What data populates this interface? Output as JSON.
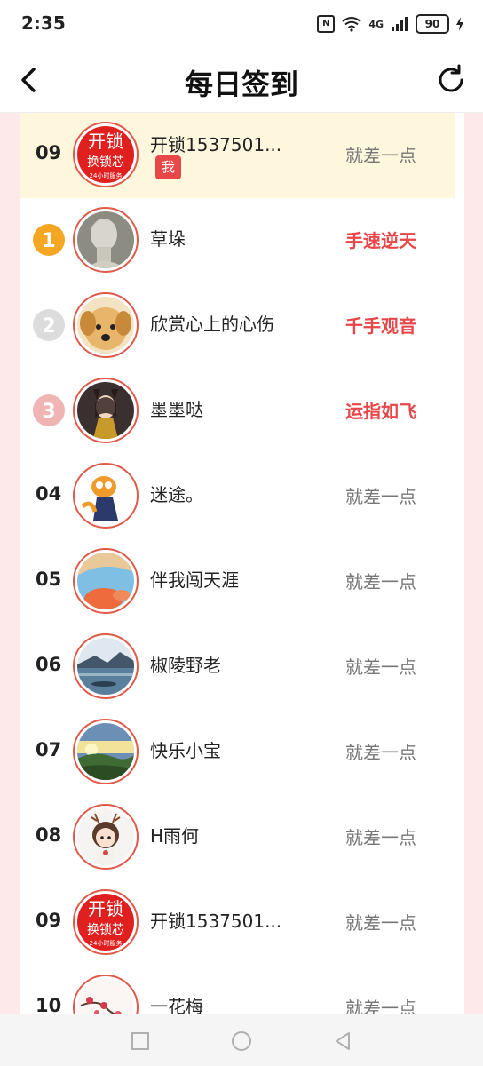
{
  "status_bar": {
    "time": "2:35",
    "network": "4G",
    "battery": "90"
  },
  "header": {
    "title": "每日签到"
  },
  "my_row": {
    "rank": "09",
    "name": "开锁1537501...",
    "badge": "我",
    "status": "就差一点"
  },
  "rows": [
    {
      "rank": "1",
      "medal": "gold-medal-icon",
      "name": "草垛",
      "status": "手速逆天",
      "top": true
    },
    {
      "rank": "2",
      "medal": "silver-medal-icon",
      "name": "欣赏心上的心伤",
      "status": "千手观音",
      "top": true
    },
    {
      "rank": "3",
      "medal": "bronze-medal-icon",
      "name": "墨墨哒",
      "status": "运指如飞",
      "top": true
    },
    {
      "rank": "04",
      "name": "迷途。",
      "status": "就差一点"
    },
    {
      "rank": "05",
      "name": "伴我闯天涯",
      "status": "就差一点"
    },
    {
      "rank": "06",
      "name": "椒陵野老",
      "status": "就差一点"
    },
    {
      "rank": "07",
      "name": "快乐小宝",
      "status": "就差一点"
    },
    {
      "rank": "08",
      "name": "H雨何",
      "status": "就差一点"
    },
    {
      "rank": "09",
      "name": "开锁1537501...",
      "status": "就差一点"
    },
    {
      "rank": "10",
      "name": "一花梅",
      "status": "就差一点"
    }
  ],
  "avatars": {
    "lock_text_top": "开锁",
    "lock_text_mid": "换锁芯",
    "lock_text_bottom": "24小时服务"
  },
  "colors": {
    "accent": "#e8474a",
    "highlight": "#fff7dd",
    "side_bg": "#fde9ea",
    "gold": "#f5a623",
    "silver": "#cfcfcf",
    "bronze": "#f0b0b0"
  }
}
